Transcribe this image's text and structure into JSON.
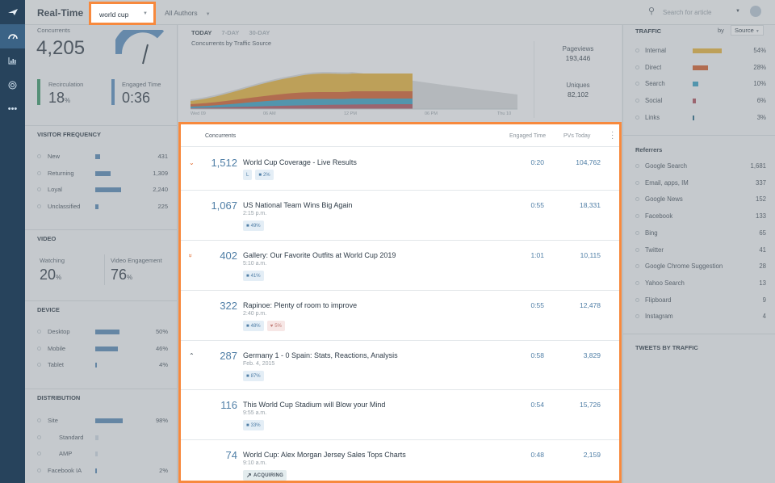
{
  "header": {
    "title": "Real-Time",
    "search_filter": "world cup",
    "authors_filter": "All Authors",
    "search_placeholder": "Search for article"
  },
  "left": {
    "concurrents_label": "Concurrents",
    "concurrents_value": "4,205",
    "recirculation_label": "Recirculation",
    "recirculation_value": "18",
    "recirculation_unit": "%",
    "engaged_time_label": "Engaged Time",
    "engaged_time_value": "0:36",
    "visitor_frequency_title": "VISITOR FREQUENCY",
    "visitor_frequency": [
      {
        "label": "New",
        "value": "431",
        "level": 0.08
      },
      {
        "label": "Returning",
        "value": "1,309",
        "level": 0.27
      },
      {
        "label": "Loyal",
        "value": "2,240",
        "level": 0.46
      },
      {
        "label": "Unclassified",
        "value": "225",
        "level": 0.05
      }
    ],
    "video_title": "VIDEO",
    "watching_label": "Watching",
    "watching_value": "20",
    "watching_unit": "%",
    "video_engagement_label": "Video Engagement",
    "video_engagement_value": "76",
    "video_engagement_unit": "%",
    "device_title": "DEVICE",
    "device": [
      {
        "label": "Desktop",
        "value": "50%",
        "level": 0.5
      },
      {
        "label": "Mobile",
        "value": "46%",
        "level": 0.46
      },
      {
        "label": "Tablet",
        "value": "4%",
        "level": 0.04
      }
    ],
    "distribution_title": "DISTRIBUTION",
    "distribution": [
      {
        "label": "Site",
        "value": "98%",
        "level": 0.98,
        "indent": false
      },
      {
        "label": "Standard",
        "value": "",
        "level": 0.1,
        "indent": true
      },
      {
        "label": "AMP",
        "value": "",
        "level": 0.08,
        "indent": true
      },
      {
        "label": "Facebook IA",
        "value": "2%",
        "level": 0.02,
        "indent": false
      }
    ]
  },
  "chart": {
    "tabs": [
      "TODAY",
      "7-DAY",
      "30-DAY"
    ],
    "title": "Concurrents by Traffic Source",
    "x_labels": [
      "Wed 09",
      "06 AM",
      "12 PM",
      "06 PM",
      "Thu 10"
    ],
    "pageviews_label": "Pageviews",
    "pageviews_value": "193,446",
    "uniques_label": "Uniques",
    "uniques_value": "82,102"
  },
  "traffic": {
    "title": "TRAFFIC",
    "by_label": "by",
    "source_label": "Source",
    "sources": [
      {
        "label": "Internal",
        "value": "54%",
        "level": 0.54,
        "color": "#e7b33d"
      },
      {
        "label": "Direct",
        "value": "28%",
        "level": 0.28,
        "color": "#d4602e"
      },
      {
        "label": "Search",
        "value": "10%",
        "level": 0.1,
        "color": "#3aa2c4"
      },
      {
        "label": "Social",
        "value": "6%",
        "level": 0.06,
        "color": "#b05560"
      },
      {
        "label": "Links",
        "value": "3%",
        "level": 0.03,
        "color": "#2a6b86"
      }
    ],
    "referrers_title": "Referrers",
    "referrers": [
      {
        "label": "Google Search",
        "value": "1,681"
      },
      {
        "label": "Email, apps, IM",
        "value": "337"
      },
      {
        "label": "Google News",
        "value": "152"
      },
      {
        "label": "Facebook",
        "value": "133"
      },
      {
        "label": "Bing",
        "value": "65"
      },
      {
        "label": "Twitter",
        "value": "41"
      },
      {
        "label": "Google Chrome Suggestions",
        "value": "28"
      },
      {
        "label": "Yahoo Search",
        "value": "13"
      },
      {
        "label": "Flipboard",
        "value": "9"
      },
      {
        "label": "Instagram",
        "value": "4"
      }
    ],
    "tweets_title": "TWEETS BY TRAFFIC"
  },
  "list": {
    "col_concurrents": "Concurrents",
    "col_engaged": "Engaged Time",
    "col_pvs": "PVs Today",
    "articles": [
      {
        "concurrents": "1,512",
        "title": "World Cup Coverage - Live Results",
        "time": "",
        "engaged": "0:20",
        "pvs": "104,762",
        "trend": "down",
        "badges": [
          {
            "type": "live",
            "text": "L"
          },
          {
            "type": "video",
            "text": "2%"
          }
        ]
      },
      {
        "concurrents": "1,067",
        "title": "US National Team Wins Big Again",
        "time": "2:15 p.m.",
        "engaged": "0:55",
        "pvs": "18,331",
        "trend": "",
        "badges": [
          {
            "type": "video",
            "text": "49%"
          }
        ]
      },
      {
        "concurrents": "402",
        "title": "Gallery: Our Favorite Outfits at World Cup 2019",
        "time": "5:10 a.m.",
        "engaged": "1:01",
        "pvs": "10,115",
        "trend": "down2",
        "badges": [
          {
            "type": "video",
            "text": "41%"
          }
        ]
      },
      {
        "concurrents": "322",
        "title": "Rapinoe: Plenty of room to improve",
        "time": "2:40 p.m.",
        "engaged": "0:55",
        "pvs": "12,478",
        "trend": "",
        "badges": [
          {
            "type": "video",
            "text": "48%"
          },
          {
            "type": "twitter",
            "text": "5%"
          }
        ]
      },
      {
        "concurrents": "287",
        "title": "Germany 1 - 0 Spain: Stats, Reactions, Analysis",
        "time": "Feb. 4, 2015",
        "engaged": "0:58",
        "pvs": "3,829",
        "trend": "up",
        "badges": [
          {
            "type": "video",
            "text": "87%"
          }
        ]
      },
      {
        "concurrents": "116",
        "title": "This World Cup Stadium will Blow your Mind",
        "time": "9:55 a.m.",
        "engaged": "0:54",
        "pvs": "15,726",
        "trend": "",
        "badges": [
          {
            "type": "video",
            "text": "33%"
          }
        ]
      },
      {
        "concurrents": "74",
        "title": "World Cup: Alex Morgan Jersey Sales Tops Charts",
        "time": "9:10 a.m.",
        "engaged": "0:48",
        "pvs": "2,159",
        "trend": "",
        "badges": [
          {
            "type": "acquiring",
            "text": "ACQUIRING"
          }
        ]
      }
    ]
  }
}
